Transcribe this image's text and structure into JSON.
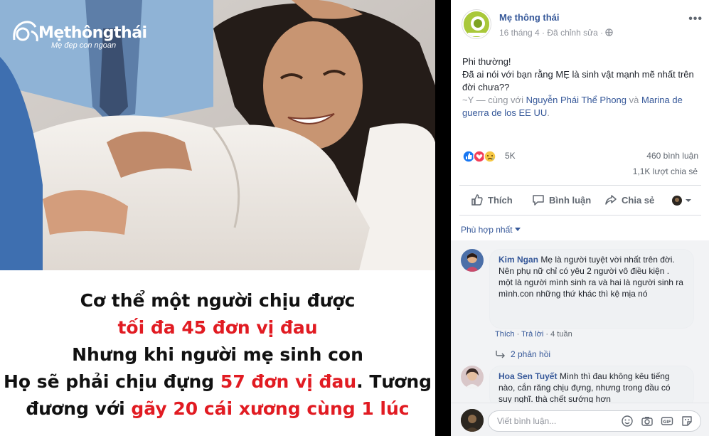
{
  "photo": {
    "logo_brand": "Mẹthôngthái",
    "logo_tag": "Mẹ đẹp con ngoan",
    "caption_lines": [
      {
        "text": "Cơ thể một người chịu được",
        "emph": ""
      },
      {
        "text": "tối đa 45 đơn vị đau",
        "emph": "red"
      },
      {
        "text": "Nhưng khi người mẹ sinh con",
        "emph": ""
      }
    ],
    "caption_line4_a": "Họ sẽ phải chịu đựng ",
    "caption_line4_red": "57 đơn vị đau",
    "caption_line4_b": ". Tương",
    "caption_line5_a": "đương với ",
    "caption_line5_red": "gãy 20 cái xương cùng 1 lúc",
    "accent_red": "#e11b22"
  },
  "post": {
    "page_name": "Mẹ thông thái",
    "date": "16 tháng 4",
    "edited": "Đã chỉnh sửa",
    "globe_icon": "globe-icon",
    "more": "•••",
    "text_line1": "Phi thường!",
    "text_line2": "Đã ai nói với bạn rằng MẸ là sinh vật mạnh mẽ nhất trên đời chưa??",
    "text_sig": "~Y",
    "text_with": " — cùng với ",
    "tag1": "Nguyễn Phái Thể Phong",
    "text_and": " và ",
    "tag2": "Marina de guerra de los EE UU",
    "text_end": "."
  },
  "stats": {
    "reactions": "5K",
    "comments": "460 bình luận",
    "shares": "1,1K lượt chia sẻ"
  },
  "actions": {
    "like": "Thích",
    "comment": "Bình luận",
    "share": "Chia sẻ"
  },
  "sort": "Phù hợp nhất",
  "comments": [
    {
      "name": "Kim Ngan",
      "text": "Mẹ là người tuyệt vời nhất trên đời.",
      "text2": "Nên phụ nữ chỉ có yêu 2 người vô điều kiện . một là người mình sinh ra và hai là người sinh ra mình.con những thứ khác thì kệ mịa nó",
      "like": "Thích",
      "reply": "Trả lời",
      "time": "4 tuần",
      "replies": "2 phản hồi"
    },
    {
      "name": "Hoa Sen Tuyết",
      "text": "Mình thì đau không kêu tiếng nào, cắn răng chịu đựng, nhưng trong đầu có suy nghĩ. thà chết sướng hơn"
    }
  ],
  "write_placeholder": "Viết bình luận...",
  "colors": {
    "link": "#365899",
    "like_blue": "#1877f2",
    "heart_red": "#f33e58",
    "logo_green": "#a9c83a"
  }
}
